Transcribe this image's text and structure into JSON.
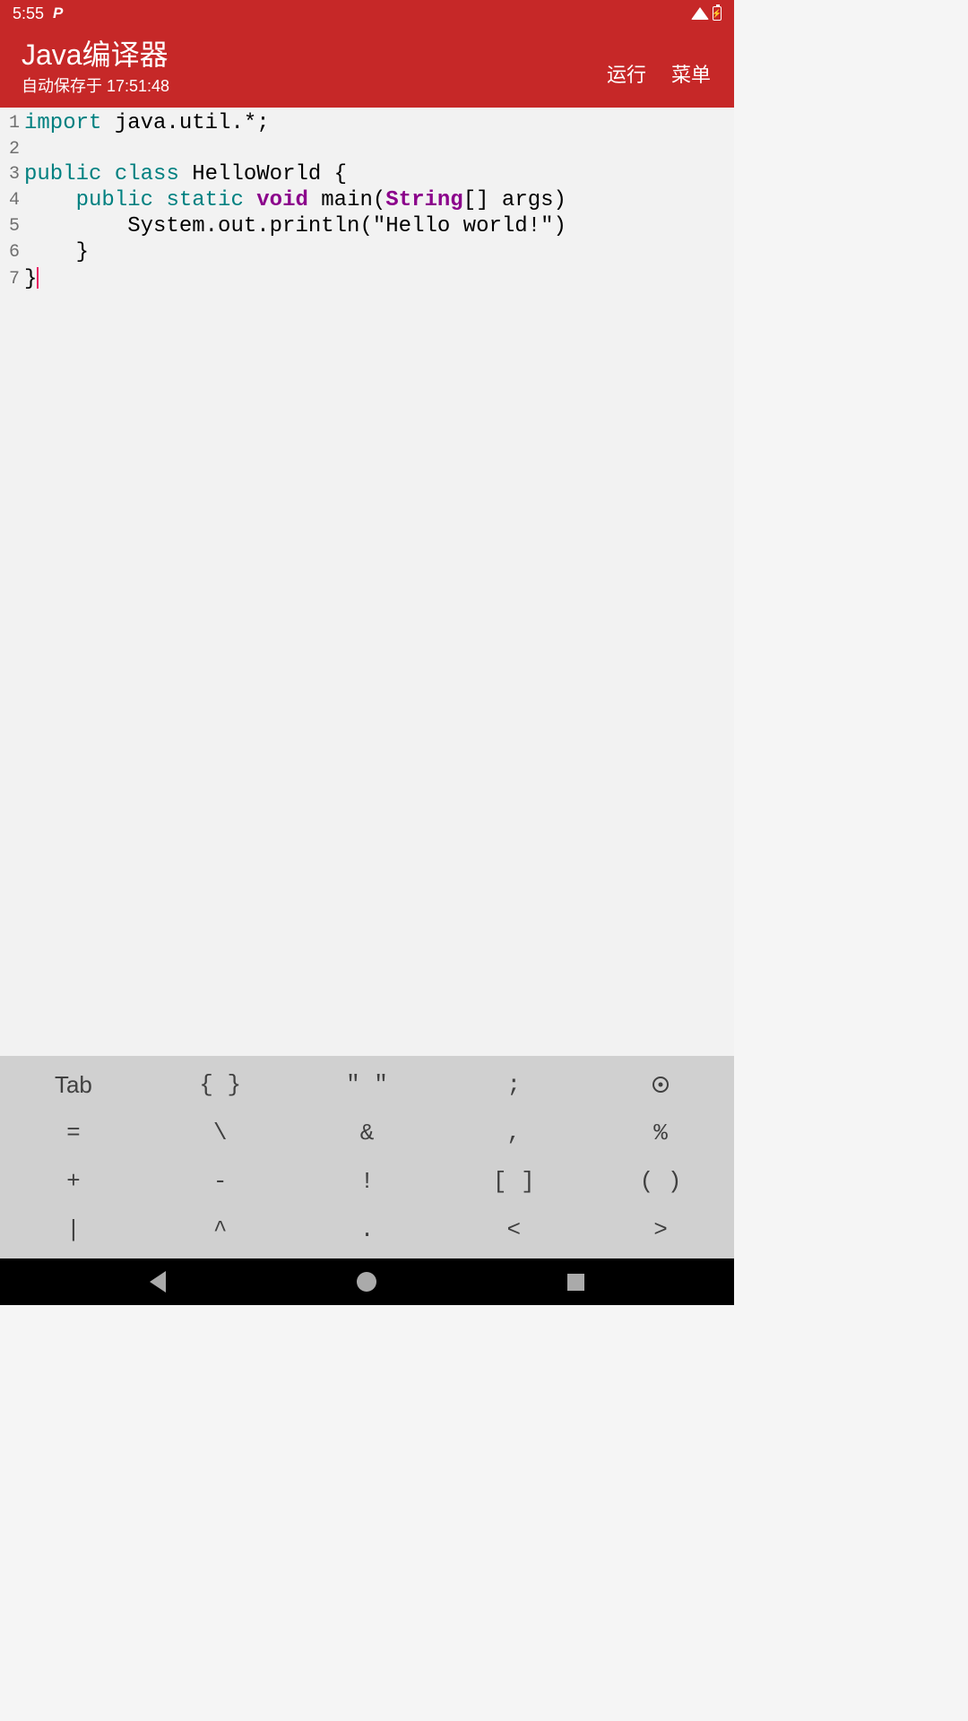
{
  "status": {
    "time": "5:55",
    "p_indicator": "P"
  },
  "appbar": {
    "title": "Java编译器",
    "subtitle": "自动保存于 17:51:48",
    "run_label": "运行",
    "menu_label": "菜单"
  },
  "code": {
    "lines": [
      {
        "num": "1",
        "tokens": [
          {
            "text": "import",
            "cls": "kw"
          },
          {
            "text": " java.util.*;",
            "cls": "plain"
          }
        ]
      },
      {
        "num": "2",
        "tokens": []
      },
      {
        "num": "3",
        "tokens": [
          {
            "text": "public",
            "cls": "kw"
          },
          {
            "text": " ",
            "cls": "plain"
          },
          {
            "text": "class",
            "cls": "kw"
          },
          {
            "text": " HelloWorld {",
            "cls": "plain"
          }
        ]
      },
      {
        "num": "4",
        "tokens": [
          {
            "text": "    ",
            "cls": "plain"
          },
          {
            "text": "public",
            "cls": "kw"
          },
          {
            "text": " ",
            "cls": "plain"
          },
          {
            "text": "static",
            "cls": "kw"
          },
          {
            "text": " ",
            "cls": "plain"
          },
          {
            "text": "void",
            "cls": "kw2"
          },
          {
            "text": " main(",
            "cls": "plain"
          },
          {
            "text": "String",
            "cls": "type"
          },
          {
            "text": "[] args)",
            "cls": "plain"
          }
        ]
      },
      {
        "num": "5",
        "tokens": [
          {
            "text": "        System.out.println(\"Hello world!\")",
            "cls": "plain"
          }
        ]
      },
      {
        "num": "6",
        "tokens": [
          {
            "text": "    }",
            "cls": "plain"
          }
        ]
      },
      {
        "num": "7",
        "tokens": [
          {
            "text": "}",
            "cls": "plain"
          }
        ],
        "cursor_after": true
      }
    ]
  },
  "symbols": {
    "rows": [
      [
        "Tab",
        "{ }",
        "\" \"",
        ";",
        "target"
      ],
      [
        "=",
        "\\",
        "&",
        ",",
        "%"
      ],
      [
        "+",
        "-",
        "!",
        "[ ]",
        "( )"
      ],
      [
        "|",
        "^",
        ".",
        "<",
        ">"
      ]
    ]
  }
}
